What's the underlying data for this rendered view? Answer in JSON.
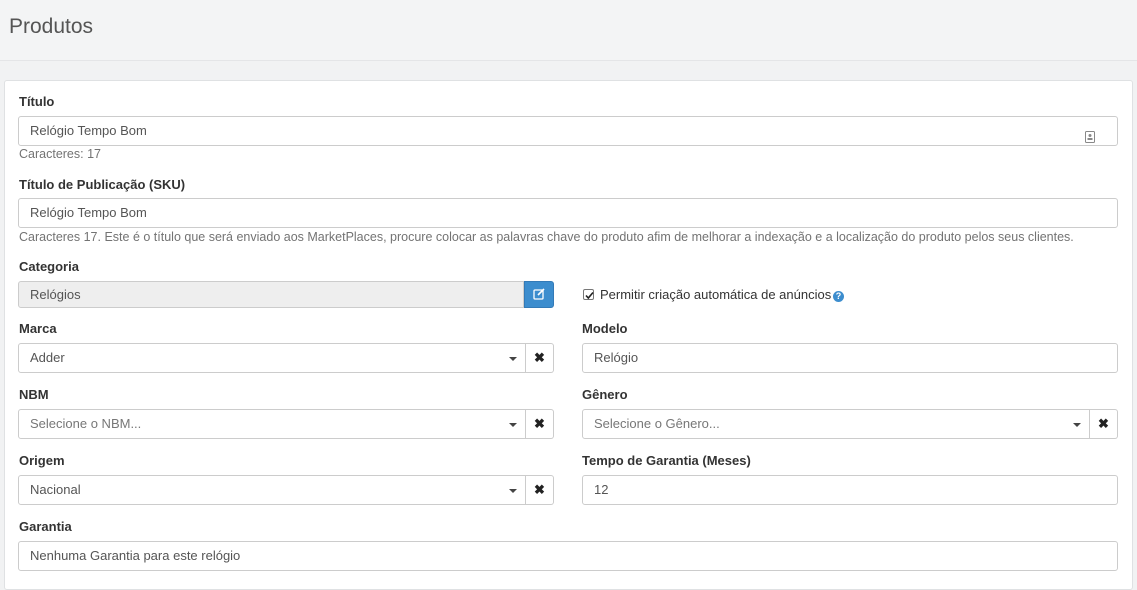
{
  "page": {
    "title": "Produtos"
  },
  "form": {
    "titulo": {
      "label": "Título",
      "value": "Relógio Tempo Bom",
      "help": "Caracteres: 17"
    },
    "titulo_publicacao": {
      "label": "Título de Publicação (SKU)",
      "value": "Relógio Tempo Bom",
      "help": "Caracteres 17. Este é o título que será enviado aos MarketPlaces, procure colocar as palavras chave do produto afim de melhorar a indexação e a localização do produto pelos seus clientes."
    },
    "categoria": {
      "label": "Categoria",
      "value": "Relógios"
    },
    "permitir_anuncios": {
      "label": "Permitir criação automática de anúncios",
      "checked": true
    },
    "marca": {
      "label": "Marca",
      "value": "Adder"
    },
    "modelo": {
      "label": "Modelo",
      "value": "Relógio"
    },
    "nbm": {
      "label": "NBM",
      "placeholder": "Selecione o NBM..."
    },
    "genero": {
      "label": "Gênero",
      "placeholder": "Selecione o Gênero..."
    },
    "origem": {
      "label": "Origem",
      "value": "Nacional"
    },
    "tempo_garantia": {
      "label": "Tempo de Garantia (Meses)",
      "value": "12"
    },
    "garantia": {
      "label": "Garantia",
      "value": "Nenhuma Garantia para este relógio"
    }
  },
  "icons": {
    "clear": "close-icon",
    "edit": "edit-icon",
    "caret": "caret-down-icon",
    "help": "question-icon",
    "contact": "contact-card-icon"
  },
  "colors": {
    "primary_button": "#3c8dce"
  }
}
